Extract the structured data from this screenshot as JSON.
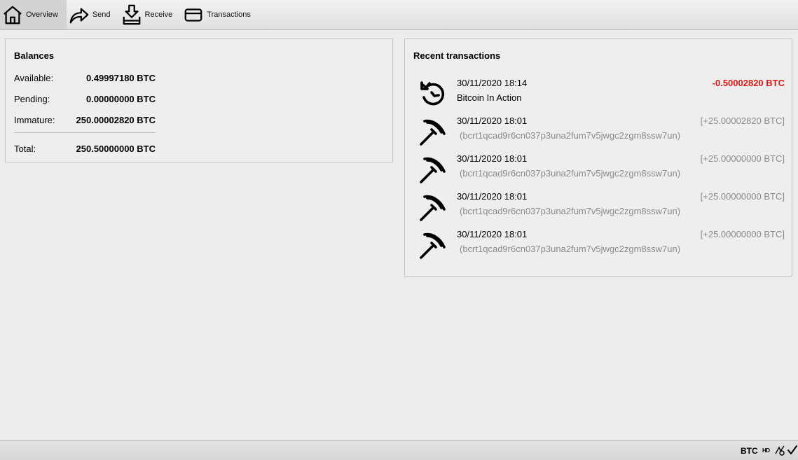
{
  "toolbar": {
    "overview_label": "Overview",
    "send_label": "Send",
    "receive_label": "Receive",
    "transactions_label": "Transactions"
  },
  "balances": {
    "title": "Balances",
    "available_label": "Available:",
    "available_value": "0.49997180 BTC",
    "pending_label": "Pending:",
    "pending_value": "0.00000000 BTC",
    "immature_label": "Immature:",
    "immature_value": "250.00002820 BTC",
    "total_label": "Total:",
    "total_value": "250.50000000 BTC"
  },
  "recent": {
    "title": "Recent transactions",
    "items": [
      {
        "icon": "sent-icon",
        "date": "30/11/2020 18:14",
        "amount": "-0.50002820 BTC",
        "label": "Bitcoin In Action",
        "address": ""
      },
      {
        "icon": "mined-icon",
        "date": "30/11/2020 18:01",
        "amount": "[+25.00002820 BTC]",
        "label": "",
        "address": "(bcrt1qcad9r6cn037p3una2fum7v5jwgc2zgm8ssw7un)"
      },
      {
        "icon": "mined-icon",
        "date": "30/11/2020 18:01",
        "amount": "[+25.00000000 BTC]",
        "label": "",
        "address": "(bcrt1qcad9r6cn037p3una2fum7v5jwgc2zgm8ssw7un)"
      },
      {
        "icon": "mined-icon",
        "date": "30/11/2020 18:01",
        "amount": "[+25.00000000 BTC]",
        "label": "",
        "address": "(bcrt1qcad9r6cn037p3una2fum7v5jwgc2zgm8ssw7un)"
      },
      {
        "icon": "mined-icon",
        "date": "30/11/2020 18:01",
        "amount": "[+25.00000000 BTC]",
        "label": "",
        "address": "(bcrt1qcad9r6cn037p3una2fum7v5jwgc2zgm8ssw7un)"
      }
    ]
  },
  "statusbar": {
    "unit": "BTC",
    "hd": "HD",
    "network_icon": "network-activity-icon",
    "sync_icon": "synced-check-icon"
  },
  "colors": {
    "negative": "#e01515",
    "muted": "#8a8a8a"
  }
}
